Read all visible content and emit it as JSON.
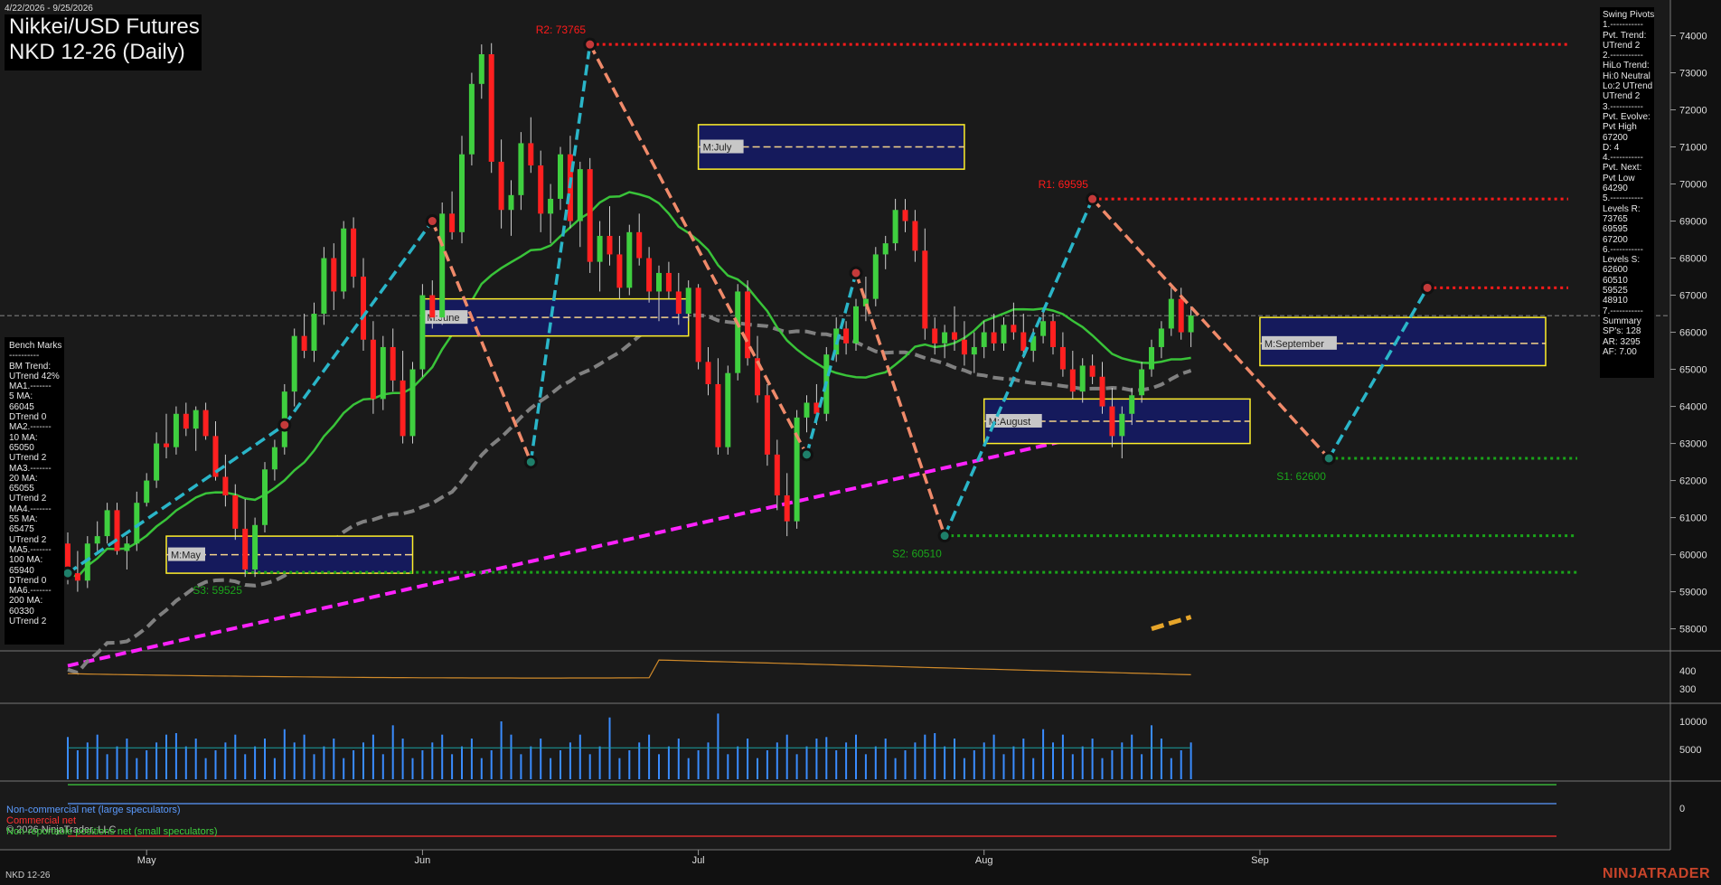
{
  "header": {
    "date_range": "4/22/2026 - 9/25/2026",
    "title_line1": "Nikkei/USD Futures",
    "title_line2": "NKD 12-26 (Daily)"
  },
  "bench_marks": {
    "lines": [
      "Bench Marks",
      "----------",
      "BM Trend:",
      "UTrend 42%",
      "MA1.-------",
      "5 MA:",
      "66045",
      "DTrend 0",
      "MA2.-------",
      "10 MA:",
      "65050",
      "UTrend 2",
      "MA3.-------",
      "20 MA:",
      "65055",
      "UTrend 2",
      "MA4.-------",
      "55 MA:",
      "65475",
      "UTrend 2",
      "MA5.-------",
      "100 MA:",
      "65940",
      "DTrend 0",
      "MA6.-------",
      "200 MA:",
      "60330",
      "UTrend 2"
    ]
  },
  "swing_pivots": {
    "lines": [
      "Swing Pivots",
      "1.-----------",
      "Pvt. Trend:",
      "UTrend 2",
      "2.-----------",
      "HiLo Trend:",
      "Hi:0 Neutral",
      "Lo:2 UTrend",
      "UTrend 2",
      "3.-----------",
      "Pvt. Evolve:",
      "Pvt High",
      "67200",
      "D: 4",
      "4.-----------",
      "Pvt. Next:",
      "Pvt Low",
      "64290",
      "5.-----------",
      "Levels R:",
      "73765",
      "69595",
      "67200",
      "6.-----------",
      "Levels S:",
      "62600",
      "60510",
      "59525",
      "48910",
      "7.-----------",
      "Summary",
      "SP's: 128",
      "AR: 3295",
      "AF: 7.00"
    ]
  },
  "legend": {
    "noncommercial": "Non-commercial net (large speculators)",
    "commercial": "Commercial net",
    "small": "Non-reportable positions net (small speculators)",
    "copyright": "© 2026 NinjaTrader, LLC"
  },
  "footer": {
    "symbol": "NKD 12-26",
    "brand": "NINJATRADER"
  },
  "colors": {
    "up": "#3fcf3f",
    "down": "#ff2020",
    "swing_up": "#2ab5c8",
    "swing_down": "#f08a6a",
    "resistance": "#ff1a1a",
    "support": "#1aa51a",
    "ma200": "#ff22ff",
    "ma100": "#808080",
    "ma_green": "#39c339",
    "ma_orange": "#e6a52a"
  },
  "chart_data": {
    "type": "candlestick",
    "ylim": [
      57600,
      74500
    ],
    "y_ticks": [
      58000,
      59000,
      60000,
      61000,
      62000,
      63000,
      64000,
      65000,
      66000,
      67000,
      68000,
      69000,
      70000,
      71000,
      72000,
      73000,
      74000
    ],
    "month_labels": [
      {
        "label": "May",
        "index": 8
      },
      {
        "label": "Jun",
        "index": 36
      },
      {
        "label": "Jul",
        "index": 64
      },
      {
        "label": "Aug",
        "index": 93
      },
      {
        "label": "Sep",
        "index": 121
      }
    ],
    "current_price": 66450,
    "candles": [
      [
        60300,
        60600,
        59200,
        59500
      ],
      [
        59500,
        60100,
        59000,
        59300
      ],
      [
        59300,
        60500,
        59100,
        60300
      ],
      [
        60300,
        60900,
        60100,
        60500
      ],
      [
        60500,
        61400,
        60300,
        61200
      ],
      [
        61200,
        61400,
        60000,
        60100
      ],
      [
        60100,
        60500,
        59600,
        60300
      ],
      [
        60300,
        61700,
        60100,
        61400
      ],
      [
        61400,
        62200,
        61300,
        62000
      ],
      [
        62000,
        63300,
        61800,
        63000
      ],
      [
        63000,
        63800,
        62600,
        62900
      ],
      [
        62900,
        64000,
        62700,
        63800
      ],
      [
        63800,
        64100,
        63200,
        63400
      ],
      [
        63400,
        64000,
        62800,
        63900
      ],
      [
        63900,
        64100,
        63100,
        63200
      ],
      [
        63200,
        63600,
        62000,
        62100
      ],
      [
        62100,
        62700,
        61300,
        61600
      ],
      [
        61600,
        61900,
        60400,
        60700
      ],
      [
        60700,
        61500,
        59400,
        59600
      ],
      [
        59600,
        61000,
        59400,
        60800
      ],
      [
        60800,
        62500,
        60600,
        62300
      ],
      [
        62300,
        63100,
        62000,
        62900
      ],
      [
        62900,
        64600,
        62700,
        64400
      ],
      [
        64400,
        66100,
        64000,
        65900
      ],
      [
        65900,
        66500,
        65300,
        65500
      ],
      [
        65500,
        66800,
        65200,
        66500
      ],
      [
        66500,
        68300,
        66200,
        68000
      ],
      [
        68000,
        68400,
        66600,
        67100
      ],
      [
        67100,
        69000,
        66900,
        68800
      ],
      [
        68800,
        69100,
        67200,
        67500
      ],
      [
        67500,
        68000,
        65500,
        65800
      ],
      [
        65800,
        66300,
        63800,
        64200
      ],
      [
        64200,
        65900,
        63900,
        65600
      ],
      [
        65600,
        66100,
        64400,
        64700
      ],
      [
        64700,
        65500,
        63000,
        63200
      ],
      [
        63200,
        65200,
        63000,
        65000
      ],
      [
        65000,
        67300,
        64800,
        67000
      ],
      [
        67000,
        67400,
        66100,
        66400
      ],
      [
        66400,
        69500,
        66200,
        69200
      ],
      [
        69200,
        69800,
        68500,
        68700
      ],
      [
        68700,
        71300,
        68400,
        70800
      ],
      [
        70800,
        73000,
        70500,
        72700
      ],
      [
        72700,
        73765,
        72300,
        73500
      ],
      [
        73500,
        73800,
        70300,
        70600
      ],
      [
        70600,
        71200,
        68800,
        69300
      ],
      [
        69300,
        70100,
        68600,
        69700
      ],
      [
        69700,
        71400,
        69300,
        71100
      ],
      [
        71100,
        71800,
        70300,
        70500
      ],
      [
        70500,
        70900,
        68700,
        69200
      ],
      [
        69200,
        70000,
        68400,
        69600
      ],
      [
        69600,
        71000,
        69300,
        70800
      ],
      [
        70800,
        71300,
        68800,
        69000
      ],
      [
        69000,
        70600,
        68300,
        70400
      ],
      [
        70400,
        70700,
        67600,
        67900
      ],
      [
        67900,
        69000,
        67100,
        68600
      ],
      [
        68600,
        69400,
        67800,
        68100
      ],
      [
        68100,
        68600,
        66900,
        67200
      ],
      [
        67200,
        68900,
        67000,
        68700
      ],
      [
        68700,
        69200,
        67800,
        68000
      ],
      [
        68000,
        68300,
        66800,
        67100
      ],
      [
        67100,
        67800,
        66300,
        67600
      ],
      [
        67600,
        67900,
        66900,
        67100
      ],
      [
        67100,
        67600,
        66200,
        66500
      ],
      [
        66500,
        67400,
        66300,
        67200
      ],
      [
        67200,
        67300,
        65000,
        65200
      ],
      [
        65200,
        65600,
        64300,
        64600
      ],
      [
        64600,
        65300,
        62700,
        62900
      ],
      [
        62900,
        65100,
        62700,
        64900
      ],
      [
        64900,
        67300,
        64700,
        67100
      ],
      [
        67100,
        67400,
        65100,
        65300
      ],
      [
        65300,
        65900,
        64100,
        64300
      ],
      [
        64300,
        64600,
        62400,
        62700
      ],
      [
        62700,
        63100,
        61200,
        61600
      ],
      [
        61600,
        62200,
        60500,
        60900
      ],
      [
        60900,
        63900,
        60700,
        63700
      ],
      [
        63700,
        64300,
        63300,
        64100
      ],
      [
        64100,
        64600,
        63500,
        63800
      ],
      [
        63800,
        65600,
        63600,
        65400
      ],
      [
        65400,
        66400,
        65200,
        66100
      ],
      [
        66100,
        66300,
        65400,
        65700
      ],
      [
        65700,
        66900,
        65500,
        66700
      ],
      [
        66700,
        67500,
        66300,
        66900
      ],
      [
        66900,
        68300,
        66700,
        68100
      ],
      [
        68100,
        68600,
        67700,
        68400
      ],
      [
        68400,
        69600,
        68200,
        69300
      ],
      [
        69300,
        69595,
        68700,
        69000
      ],
      [
        69000,
        69300,
        67900,
        68200
      ],
      [
        68200,
        68800,
        65800,
        66100
      ],
      [
        66100,
        66400,
        65400,
        65700
      ],
      [
        65700,
        66200,
        65300,
        66000
      ],
      [
        66000,
        66700,
        65500,
        65800
      ],
      [
        65800,
        66300,
        65100,
        65400
      ],
      [
        65400,
        66000,
        64900,
        65600
      ],
      [
        65600,
        66300,
        65300,
        66000
      ],
      [
        66000,
        66500,
        65500,
        65700
      ],
      [
        65700,
        66400,
        65500,
        66200
      ],
      [
        66200,
        66800,
        65800,
        66000
      ],
      [
        66000,
        66500,
        65300,
        65500
      ],
      [
        65500,
        66100,
        65200,
        65900
      ],
      [
        65900,
        66600,
        65700,
        66300
      ],
      [
        66300,
        66500,
        65400,
        65600
      ],
      [
        65600,
        66000,
        64800,
        65000
      ],
      [
        65000,
        65500,
        64200,
        64400
      ],
      [
        64400,
        65300,
        64100,
        65100
      ],
      [
        65100,
        65400,
        64600,
        64800
      ],
      [
        64800,
        65200,
        63800,
        64000
      ],
      [
        64000,
        64500,
        62900,
        63200
      ],
      [
        63200,
        64000,
        62600,
        63800
      ],
      [
        63800,
        64500,
        63500,
        64300
      ],
      [
        64300,
        65200,
        64100,
        65000
      ],
      [
        65000,
        65800,
        64800,
        65600
      ],
      [
        65600,
        66300,
        65300,
        66100
      ],
      [
        66100,
        67200,
        65900,
        66900
      ],
      [
        66900,
        67200,
        65800,
        66000
      ],
      [
        66000,
        66700,
        65600,
        66450
      ]
    ],
    "resistance_levels": [
      {
        "label": "R2: 73765",
        "value": 73765
      },
      {
        "label": "R1: 69595",
        "value": 69595
      },
      {
        "label": "",
        "value": 67200
      }
    ],
    "support_levels": [
      {
        "label": "S1: 62600",
        "value": 62600
      },
      {
        "label": "S2: 60510",
        "value": 60510
      },
      {
        "label": "S3: 59525",
        "value": 59525
      }
    ],
    "monthly_boxes": [
      {
        "label": "M:May",
        "start": 10,
        "end": 35,
        "high": 60500,
        "low": 59500,
        "mid": 60000
      },
      {
        "label": "M:June",
        "start": 36,
        "end": 63,
        "high": 66900,
        "low": 65900,
        "mid": 66400
      },
      {
        "label": "M:July",
        "start": 64,
        "end": 91,
        "high": 71600,
        "low": 70400,
        "mid": 71000
      },
      {
        "label": "M:August",
        "start": 93,
        "end": 120,
        "high": 64200,
        "low": 63000,
        "mid": 63600
      },
      {
        "label": "M:September",
        "start": 121,
        "end": 150,
        "high": 66400,
        "low": 65100,
        "mid": 65700
      }
    ],
    "swing_points": [
      [
        0,
        59500
      ],
      [
        22,
        63500
      ],
      [
        37,
        69000
      ],
      [
        47,
        62500
      ],
      [
        53,
        73765
      ],
      [
        75,
        62700
      ],
      [
        80,
        67600
      ],
      [
        89,
        60510
      ],
      [
        104,
        69595
      ],
      [
        128,
        62600
      ],
      [
        138,
        67200
      ]
    ],
    "lower_panels": [
      {
        "name": "ATR",
        "ticks": [
          300,
          400
        ]
      },
      {
        "name": "Volume",
        "ticks": [
          5000,
          10000
        ]
      },
      {
        "name": "COT",
        "ticks": [
          0
        ]
      }
    ]
  }
}
